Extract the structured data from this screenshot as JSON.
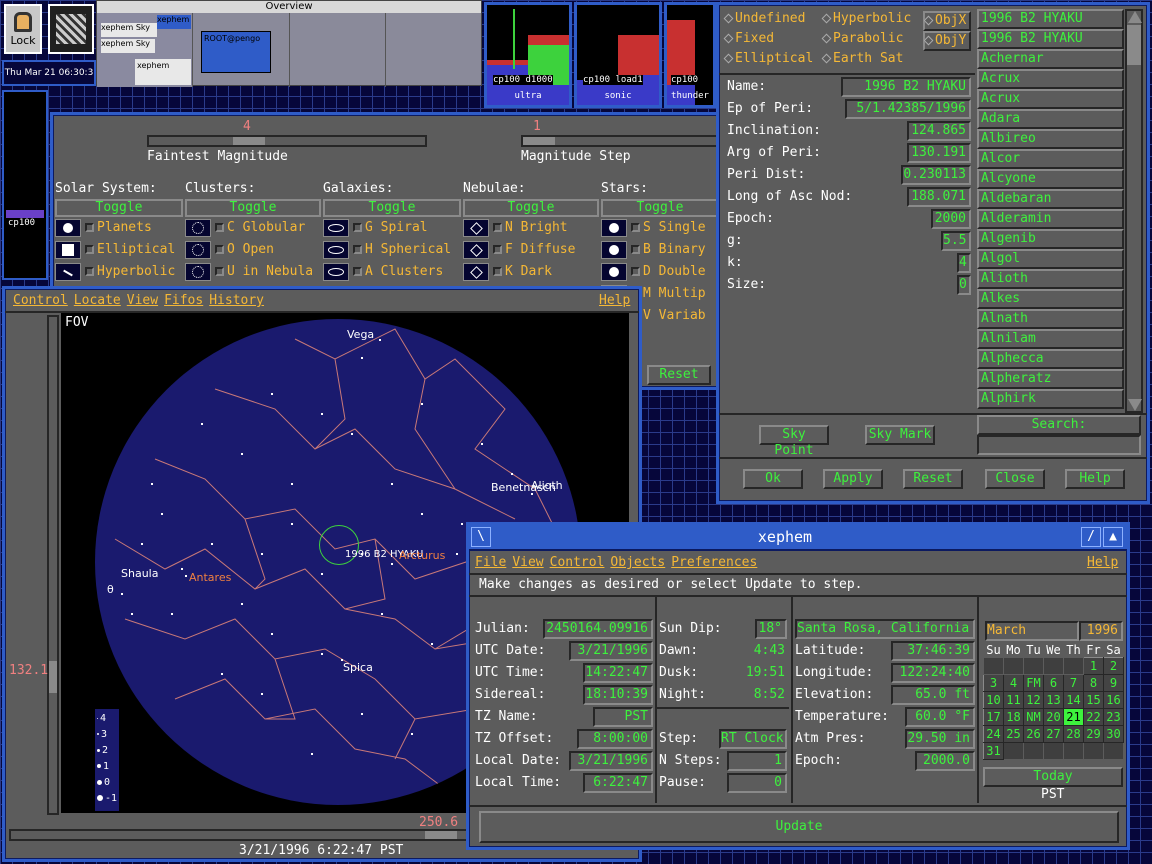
{
  "desktop": {
    "lock_label": "Lock",
    "clock": "Thu Mar 21 06:30:3",
    "overview_title": "Overview",
    "pager_labels": [
      "xephem",
      "xephem Sky",
      "xephem Sky",
      "ROOT@pengo",
      "xephem"
    ]
  },
  "meters": [
    {
      "labels": [
        "cp100",
        "d1000"
      ],
      "caption": "ultra"
    },
    {
      "labels": [
        "cp100",
        "load1"
      ],
      "caption": "sonic"
    },
    {
      "labels": [
        "cp100",
        ""
      ],
      "caption": "thunder"
    }
  ],
  "side_meter": {
    "label": "cp100"
  },
  "filter": {
    "faintest_value": "4",
    "faintest_label": "Faintest Magnitude",
    "step_value": "1",
    "step_label": "Magnitude Step",
    "reset_label": "Reset",
    "columns": [
      {
        "title": "Solar System:",
        "toggle": "Toggle",
        "items": [
          "Planets",
          "Elliptical",
          "Hyperbolic"
        ]
      },
      {
        "title": "Clusters:",
        "toggle": "Toggle",
        "items": [
          "C Globular",
          "O Open",
          "U in Nebula"
        ]
      },
      {
        "title": "Galaxies:",
        "toggle": "Toggle",
        "items": [
          "G Spiral",
          "H Spherical",
          "A Clusters"
        ]
      },
      {
        "title": "Nebulae:",
        "toggle": "Toggle",
        "items": [
          "N Bright",
          "F Diffuse",
          "K Dark"
        ]
      },
      {
        "title": "Stars:",
        "toggle": "Toggle",
        "items": [
          "S Single",
          "B Binary",
          "D Double",
          "M Multip",
          "V Variab"
        ]
      }
    ]
  },
  "sky": {
    "menu": [
      "Control",
      "Locate",
      "View",
      "Fifos",
      "History"
    ],
    "help": "Help",
    "fov_label": "FOV",
    "alt_value": "132.1",
    "az_value": "250.6",
    "status": "3/21/1996   6:22:47 PST",
    "legend": [
      "4",
      "3",
      "2",
      "1",
      "0",
      "-1"
    ],
    "labels": {
      "vega": "Vega",
      "benetnasch": "Benetnasch",
      "alioth": "Alioth",
      "shaula": "Shaula",
      "antares": "Antares",
      "spica": "Spica",
      "theta": "θ",
      "hyaku": "1996 B2 HYAKU",
      "arcturus": "Arcturus"
    }
  },
  "objedit": {
    "types": [
      "Undefined",
      "Fixed",
      "Elliptical",
      "Hyperbolic",
      "Parabolic",
      "Earth Sat"
    ],
    "objx": "ObjX",
    "objy": "ObjY",
    "fields": [
      {
        "label": "Name:",
        "value": "1996 B2 HYAKU"
      },
      {
        "label": "Ep of Peri:",
        "value": "5/1.42385/1996"
      },
      {
        "label": "Inclination:",
        "value": "124.865"
      },
      {
        "label": "Arg of Peri:",
        "value": "130.191"
      },
      {
        "label": "Peri Dist:",
        "value": "0.230113"
      },
      {
        "label": "Long of Asc Nod:",
        "value": "188.071"
      },
      {
        "label": "Epoch:",
        "value": "2000"
      },
      {
        "label": "g:",
        "value": "5.5"
      },
      {
        "label": "k:",
        "value": "4"
      },
      {
        "label": "Size:",
        "value": "0"
      }
    ],
    "list": [
      "1996 B2 HYAKU",
      "1996 B2 HYAKU",
      "Achernar",
      "Acrux",
      "Acrux",
      "Adara",
      "Albireo",
      "Alcor",
      "Alcyone",
      "Aldebaran",
      "Alderamin",
      "Algenib",
      "Algol",
      "Alioth",
      "Alkes",
      "Alnath",
      "Alnilam",
      "Alphecca",
      "Alpheratz",
      "Alphirk"
    ],
    "sky_point": "Sky Point",
    "sky_mark": "Sky Mark",
    "search_label": "Search:",
    "search_value": "",
    "buttons": [
      "Ok",
      "Apply",
      "Reset",
      "Close",
      "Help"
    ]
  },
  "main": {
    "title": "xephem",
    "menu": [
      "File",
      "View",
      "Control",
      "Objects",
      "Preferences"
    ],
    "help": "Help",
    "message": "Make changes as desired or select Update to step.",
    "time_fields": [
      {
        "label": "Julian:",
        "value": "2450164.09916"
      },
      {
        "label": "UTC Date:",
        "value": "3/21/1996"
      },
      {
        "label": "UTC Time:",
        "value": "14:22:47"
      },
      {
        "label": "Sidereal:",
        "value": "18:10:39"
      },
      {
        "label": "TZ Name:",
        "value": "PST"
      },
      {
        "label": "TZ Offset:",
        "value": "8:00:00"
      },
      {
        "label": "Local Date:",
        "value": "3/21/1996"
      },
      {
        "label": "Local Time:",
        "value": "6:22:47"
      }
    ],
    "sun_fields": [
      {
        "label": "Sun Dip:",
        "value": "18°"
      },
      {
        "label": "Dawn:",
        "value": "4:43"
      },
      {
        "label": "Dusk:",
        "value": "19:51"
      },
      {
        "label": "Night:",
        "value": "8:52"
      }
    ],
    "step_fields": [
      {
        "label": "Step:",
        "value": "RT Clock"
      },
      {
        "label": "N Steps:",
        "value": "1"
      },
      {
        "label": "Pause:",
        "value": "0"
      }
    ],
    "site": "Santa Rosa, California",
    "site_fields": [
      {
        "label": "Latitude:",
        "value": "37:46:39"
      },
      {
        "label": "Longitude:",
        "value": "122:24:40"
      },
      {
        "label": "Elevation:",
        "value": "65.0 ft"
      },
      {
        "label": "Temperature:",
        "value": "60.0 °F"
      },
      {
        "label": "Atm Pres:",
        "value": "29.50 in"
      },
      {
        "label": "Epoch:",
        "value": "2000.0"
      }
    ],
    "calendar": {
      "month": "March",
      "year": "1996",
      "days_header": [
        "Su",
        "Mo",
        "Tu",
        "We",
        "Th",
        "Fr",
        "Sa"
      ],
      "weeks": [
        [
          "",
          "",
          "",
          "",
          "",
          "1",
          "2"
        ],
        [
          "3",
          "4",
          "FM",
          "6",
          "7",
          "8",
          "9"
        ],
        [
          "10",
          "11",
          "12",
          "13",
          "14",
          "15",
          "16"
        ],
        [
          "17",
          "18",
          "NM",
          "20",
          "21",
          "22",
          "23"
        ],
        [
          "24",
          "25",
          "26",
          "27",
          "28",
          "29",
          "30"
        ],
        [
          "31",
          "",
          "",
          "",
          "",
          "",
          ""
        ]
      ],
      "today_label": "Today",
      "tz": "PST"
    },
    "update_label": "Update"
  }
}
